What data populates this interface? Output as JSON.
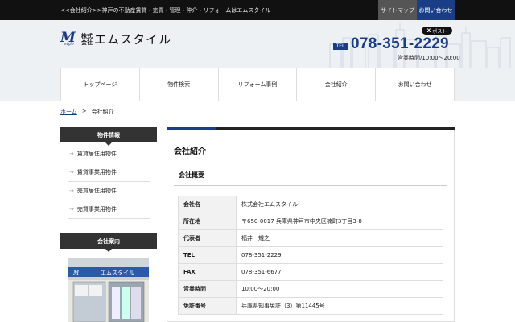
{
  "topbar": {
    "crumb_text": "<<会社紹介>>神戸の不動産賃貸・売買・管理・仲介・リフォームはエムスタイル",
    "sitemap_label": "サイトマップ",
    "contact_label": "お問い合わせ"
  },
  "header": {
    "logo_mark": "M",
    "logo_style": "style",
    "logo_kabu_line1": "株式",
    "logo_kabu_line2": "会社",
    "logo_name": "エムスタイル",
    "xpost_label": "ポスト",
    "tel_badge": "TEL",
    "tel_number": "078-351-2229",
    "hours": "営業時間/10:00〜20:00"
  },
  "nav": {
    "items": [
      "トップページ",
      "物件検索",
      "リフォーム事例",
      "会社紹介",
      "お問い合わせ"
    ]
  },
  "breadcrumb": {
    "home": "ホーム",
    "sep": ">",
    "current": "会社紹介"
  },
  "sidebar": {
    "properties_title": "物件情報",
    "properties": [
      "賃貸居住用物件",
      "賃貸事業用物件",
      "売買居住用物件",
      "売買事業用物件"
    ],
    "company_title": "会社案内",
    "photo_sign": "エムスタイル"
  },
  "main": {
    "title": "会社紹介",
    "section": "会社概要",
    "rows": [
      {
        "key": "会社名",
        "value": "株式会社エムスタイル"
      },
      {
        "key": "所在地",
        "value": "〒650-0017 兵庫県神戸市中央区楠町3丁目3-8"
      },
      {
        "key": "代表者",
        "value": "福井　規之"
      },
      {
        "key": "TEL",
        "value": "078-351-2229"
      },
      {
        "key": "FAX",
        "value": "078-351-6677"
      },
      {
        "key": "営業時間",
        "value": "10:00〜20:00"
      },
      {
        "key": "免許番号",
        "value": "兵庫県知事免許（3）第11445号"
      }
    ]
  },
  "colors": {
    "brand_blue": "#1a3d88",
    "dark": "#111111",
    "side_head": "#333333"
  }
}
